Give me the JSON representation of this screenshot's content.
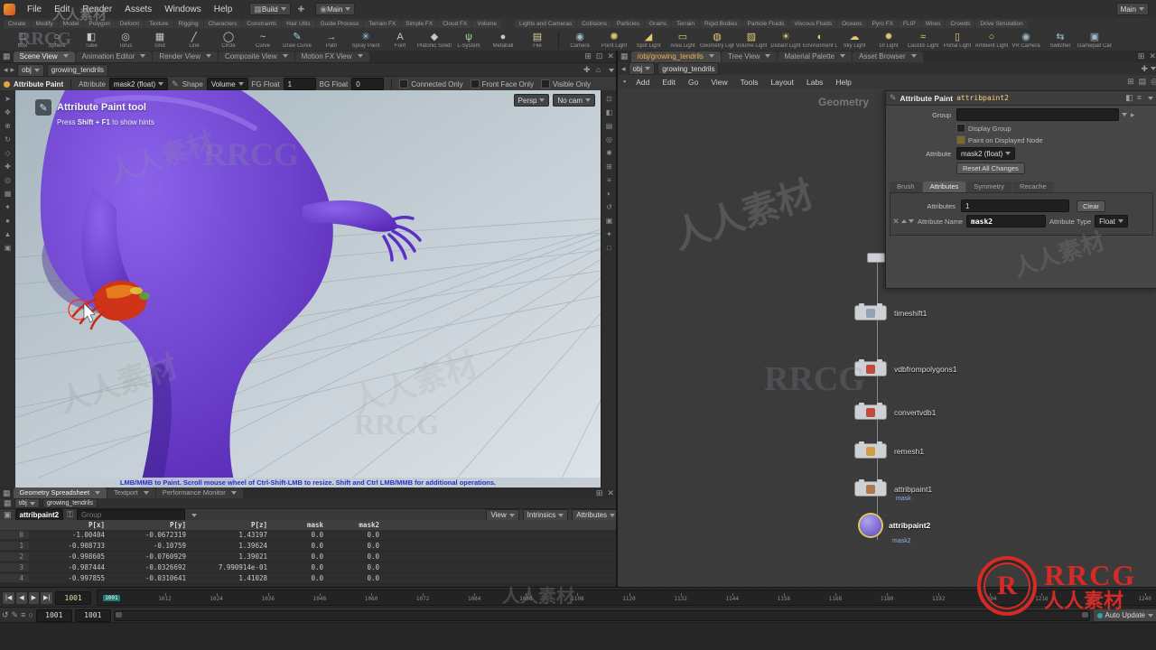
{
  "menubar": {
    "menus": [
      "File",
      "Edit",
      "Render",
      "Assets",
      "Windows",
      "Help"
    ],
    "desktop_label": "Build",
    "main_label": "Main",
    "right_label": "Main"
  },
  "shelf": {
    "left_tabs": [
      "Create",
      "Modify",
      "Model",
      "Polygon",
      "Deform",
      "Texture",
      "Rigging",
      "Characters",
      "Constraints",
      "Hair Utils",
      "Guide Process",
      "Terrain FX",
      "Simple FX",
      "Cloud FX",
      "Volume"
    ],
    "right_tabs": [
      "Lights and Cameras",
      "Collisions",
      "Particles",
      "Grains",
      "Terrain",
      "Rigid Bodies",
      "Particle Fluids",
      "Viscous Fluids",
      "Oceans",
      "Pyro FX",
      "FLIP",
      "Wires",
      "Crowds",
      "Drive Simulation"
    ],
    "left_tools": [
      {
        "label": "Box",
        "glyph": "□",
        "color": "#c2c8cd"
      },
      {
        "label": "Sphere",
        "glyph": "○",
        "color": "#c2c8cd"
      },
      {
        "label": "Tube",
        "glyph": "◧",
        "color": "#c2c8cd"
      },
      {
        "label": "Torus",
        "glyph": "◎",
        "color": "#c2c8cd"
      },
      {
        "label": "Grid",
        "glyph": "▦",
        "color": "#c2c8cd"
      },
      {
        "label": "Line",
        "glyph": "╱",
        "color": "#c2c8cd"
      },
      {
        "label": "Circle",
        "glyph": "◯",
        "color": "#c2c8cd"
      },
      {
        "label": "Curve",
        "glyph": "~",
        "color": "#9fd0e8"
      },
      {
        "label": "Draw Curve",
        "glyph": "✎",
        "color": "#9fd0e8"
      },
      {
        "label": "Path",
        "glyph": "→",
        "color": "#9fd0e8"
      },
      {
        "label": "Spray Paint",
        "glyph": "✳",
        "color": "#9fd0e8"
      },
      {
        "label": "Font",
        "glyph": "A",
        "color": "#c2c8cd"
      },
      {
        "label": "Platonic Solids",
        "glyph": "◆",
        "color": "#c2c8cd"
      },
      {
        "label": "L-System",
        "glyph": "ψ",
        "color": "#9fe0a0"
      },
      {
        "label": "Metaball",
        "glyph": "●",
        "color": "#c2c8cd"
      },
      {
        "label": "File",
        "glyph": "▤",
        "color": "#d8cf9f"
      }
    ],
    "right_tools": [
      {
        "label": "Camera",
        "glyph": "◉",
        "color": "#9fb8c8"
      },
      {
        "label": "Point Light",
        "glyph": "✺",
        "color": "#e3cc6f"
      },
      {
        "label": "Spot Light",
        "glyph": "◢",
        "color": "#e3cc6f"
      },
      {
        "label": "Area Light",
        "glyph": "▭",
        "color": "#e3cc6f"
      },
      {
        "label": "Geometry Light",
        "glyph": "◍",
        "color": "#e3cc6f"
      },
      {
        "label": "Volume Light",
        "glyph": "▨",
        "color": "#e3cc6f"
      },
      {
        "label": "Distant Light",
        "glyph": "☀",
        "color": "#e3cc6f"
      },
      {
        "label": "Environment Light",
        "glyph": "◐",
        "color": "#e3cc6f"
      },
      {
        "label": "Sky Light",
        "glyph": "☁",
        "color": "#e3cc6f"
      },
      {
        "label": "GI Light",
        "glyph": "✸",
        "color": "#e3cc6f"
      },
      {
        "label": "Caustic Light",
        "glyph": "≈",
        "color": "#e3cc6f"
      },
      {
        "label": "Portal Light",
        "glyph": "▯",
        "color": "#e3cc6f"
      },
      {
        "label": "Ambient Light",
        "glyph": "○",
        "color": "#e3cc6f"
      },
      {
        "label": "VR Camera",
        "glyph": "◉",
        "color": "#9fb8c8"
      },
      {
        "label": "Switcher",
        "glyph": "⇆",
        "color": "#9fb8c8"
      },
      {
        "label": "Gamepad Camera",
        "glyph": "▣",
        "color": "#9fb8c8"
      }
    ]
  },
  "left_pane": {
    "tabs": [
      "Scene View",
      "Animation Editor",
      "Render View",
      "Composite View",
      "Motion FX View"
    ],
    "path": [
      "obj",
      "growing_tendrils"
    ]
  },
  "paint_toolbar": {
    "tool_label": "Attribute Paint",
    "attribute_label": "Attribute",
    "attribute_value": "mask2 (float)",
    "shape_label": "Shape",
    "shape_value": "Volume",
    "fg_label": "FG Float",
    "fg_value": "1",
    "bg_label": "BG Float",
    "bg_value": "0",
    "options": [
      "Connected Only",
      "Front Face Only",
      "Visible Only"
    ]
  },
  "viewport": {
    "overlay_title": "Attribute Paint tool",
    "overlay_hint_pre": "Press ",
    "overlay_hint_key": "Shift + F1",
    "overlay_hint_post": " to show hints",
    "persp": "Persp",
    "camera": "No cam",
    "bottom_hint": "LMB/MMB to Paint.  Scroll mouse wheel of Ctrl-Shift-LMB to resize.  Shift and Ctrl LMB/MMB for additional operations.",
    "left_icons": [
      {
        "name": "select-tool-icon",
        "glyph": "➤"
      },
      {
        "name": "pose-tool-icon",
        "glyph": "✥"
      },
      {
        "name": "translate-tool-icon",
        "glyph": "⊕"
      },
      {
        "name": "rotate-tool-icon",
        "glyph": "↻"
      },
      {
        "name": "scale-tool-icon",
        "glyph": "◇"
      },
      {
        "name": "handles-tool-icon",
        "glyph": "✚"
      },
      {
        "name": "snap-tool-icon",
        "glyph": "◎"
      },
      {
        "name": "grid-tool-icon",
        "glyph": "▦"
      },
      {
        "name": "light-tool-icon",
        "glyph": "✦"
      },
      {
        "name": "key-tool-icon",
        "glyph": "●"
      },
      {
        "name": "flag-tool-icon",
        "glyph": "▲"
      },
      {
        "name": "misc-tool-icon",
        "glyph": "▣"
      }
    ],
    "right_icons": [
      {
        "name": "maximize-view-icon",
        "glyph": "⊡"
      },
      {
        "name": "shading-mode-icon",
        "glyph": "◧"
      },
      {
        "name": "wireframe-icon",
        "glyph": "▤"
      },
      {
        "name": "lookat-icon",
        "glyph": "◎"
      },
      {
        "name": "pan-icon",
        "glyph": "✱"
      },
      {
        "name": "tile-views-icon",
        "glyph": "⊞"
      },
      {
        "name": "display-options-icon",
        "glyph": "≡"
      },
      {
        "name": "lighting-icon",
        "glyph": "◐"
      },
      {
        "name": "home-view-icon",
        "glyph": "↺"
      },
      {
        "name": "snapshot-icon",
        "glyph": "▣"
      },
      {
        "name": "star-icon",
        "glyph": "✦"
      },
      {
        "name": "box-display-icon",
        "glyph": "□"
      }
    ]
  },
  "network_pane": {
    "pane_tabs": [
      "/obj/growing_tendrils",
      "Tree View",
      "Material Palette",
      "Asset Browser"
    ],
    "path": [
      "obj",
      "growing_tendrils"
    ],
    "menus": [
      "Add",
      "Edit",
      "Go",
      "View",
      "Tools",
      "Layout",
      "Labs",
      "Help"
    ],
    "context_label": "Geometry",
    "nodes": [
      {
        "name": "timeshift1",
        "color": "#8fa3b5",
        "sub": ""
      },
      {
        "name": "vdbfrompolygons1",
        "color": "#c24a3a",
        "sub": ""
      },
      {
        "name": "convertvdb1",
        "color": "#c24a3a",
        "sub": ""
      },
      {
        "name": "remesh1",
        "color": "#d49a45",
        "sub": ""
      },
      {
        "name": "attribpaint1",
        "color": "#b07848",
        "sub": "mask"
      },
      {
        "name": "attribpaint2",
        "color": "#7a5ad0",
        "sub": "mask2"
      }
    ]
  },
  "params": {
    "title": "Attribute Paint",
    "node_name": "attribpaint2",
    "group_label": "Group",
    "display_group_label": "Display Group",
    "paint_displayed_label": "Paint on Displayed Node",
    "attribute_label": "Attribute",
    "attribute_value": "mask2 (float)",
    "reset_label": "Reset All Changes",
    "tabs": [
      "Brush",
      "Attributes",
      "Symmetry",
      "Recache"
    ],
    "attributes_label": "Attributes",
    "attributes_value": "1",
    "clear_label": "Clear",
    "attr_name_label": "Attribute Name",
    "attr_name_value": "mask2",
    "attr_type_label": "Attribute Type",
    "attr_type_value": "Float"
  },
  "bottom_pane": {
    "tabs": [
      "Geometry Spreadsheet",
      "Textport",
      "Performance Monitor"
    ],
    "path": [
      "obj",
      "growing_tendrils"
    ]
  },
  "spreadsheet": {
    "node_value": "attribpaint2",
    "group_placeholder": "Group",
    "view_label": "View",
    "intrinsics_label": "Intrinsics",
    "attributes_label": "Attributes",
    "columns": [
      "P[x]",
      "P[y]",
      "P[z]",
      "mask",
      "mask2"
    ],
    "rows": [
      {
        "index": "0",
        "cells": [
          "-1.00404",
          "-0.0672319",
          "1.43197",
          "0.0",
          "0.0"
        ]
      },
      {
        "index": "1",
        "cells": [
          "-0.908733",
          "-0.10759",
          "1.39624",
          "0.0",
          "0.0"
        ]
      },
      {
        "index": "2",
        "cells": [
          "-0.998605",
          "-0.0760929",
          "1.39021",
          "0.0",
          "0.0"
        ]
      },
      {
        "index": "3",
        "cells": [
          "-0.987444",
          "-0.0326692",
          "7.990914e-01",
          "0.0",
          "0.0"
        ]
      },
      {
        "index": "4",
        "cells": [
          "-0.997855",
          "-0.0310641",
          "1.41028",
          "0.0",
          "0.0"
        ]
      }
    ]
  },
  "timeline": {
    "current": "1001",
    "ticks": [
      "1001",
      "1012",
      "1024",
      "1036",
      "1048",
      "1060",
      "1072",
      "1084",
      "1096",
      "1108",
      "1120",
      "1132",
      "1144",
      "1156",
      "1168",
      "1180",
      "1192",
      "1204",
      "1216",
      "1228",
      "1240"
    ],
    "transport": [
      "|◀",
      "◀",
      "▶",
      "▶|"
    ],
    "range_start": "1001",
    "range_end": "1001",
    "auto_update": "Auto Update"
  },
  "watermarks": [
    {
      "text": "人人素材"
    },
    {
      "text": "RRCG"
    },
    {
      "text": "RRCG"
    },
    {
      "text": "人人素材"
    },
    {
      "text": "人人素材"
    },
    {
      "text": "RRCG"
    },
    {
      "text": "人人素材"
    },
    {
      "text": "RRCG"
    },
    {
      "text": "人人素材"
    },
    {
      "text": "人人素材"
    },
    {
      "text": "人人素材"
    }
  ],
  "logo": {
    "text": "RRCG",
    "cn": "人人素材"
  }
}
